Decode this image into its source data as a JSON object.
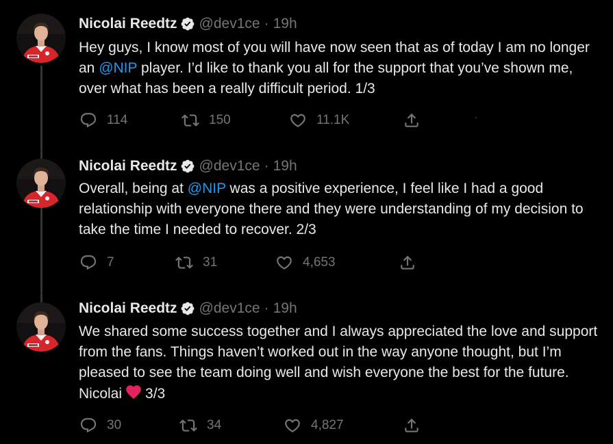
{
  "colors": {
    "background": "#000000",
    "text": "#e7e9ea",
    "muted": "#71767b",
    "link": "#1d9bf0",
    "thread_line": "#333639",
    "emoji_heart": "#e0245e"
  },
  "tweets": [
    {
      "author": {
        "name": "Nicolai Reedtz",
        "handle": "@dev1ce",
        "verified_icon": "verified-badge-icon",
        "avatar_icon": "avatar-icon"
      },
      "separator": "·",
      "time": "19h",
      "text": {
        "part1": "Hey guys, I know most of you will have now seen that as of today I am no longer an ",
        "mention": "@NIP",
        "part2": " player. I’d like to thank you all for the support that you’ve shown me, over what has been a really difficult period. 1/3"
      },
      "actions": {
        "reply": {
          "icon": "reply-icon",
          "count": "114"
        },
        "retweet": {
          "icon": "retweet-icon",
          "count": "150"
        },
        "like": {
          "icon": "heart-icon",
          "count": "11.1K"
        },
        "share": {
          "icon": "share-icon"
        }
      }
    },
    {
      "author": {
        "name": "Nicolai Reedtz",
        "handle": "@dev1ce",
        "verified_icon": "verified-badge-icon",
        "avatar_icon": "avatar-icon"
      },
      "separator": "·",
      "time": "19h",
      "text": {
        "part1": "Overall, being at ",
        "mention": "@NIP",
        "part2": " was a positive experience, I feel like I had a good relationship with everyone there and they were understanding of my decision to take the time I needed to recover. 2/3"
      },
      "actions": {
        "reply": {
          "icon": "reply-icon",
          "count": "7"
        },
        "retweet": {
          "icon": "retweet-icon",
          "count": "31"
        },
        "like": {
          "icon": "heart-icon",
          "count": "4,653"
        },
        "share": {
          "icon": "share-icon"
        }
      }
    },
    {
      "author": {
        "name": "Nicolai Reedtz",
        "handle": "@dev1ce",
        "verified_icon": "verified-badge-icon",
        "avatar_icon": "avatar-icon"
      },
      "separator": "·",
      "time": "19h",
      "text": {
        "part1": "We shared some success together and I always appreciated the love and support from the fans. Things haven’t worked out in the way anyone thought, but I’m pleased to see the team doing well and wish everyone the best for the future. Nicolai",
        "emoji": "red-heart-emoji",
        "part2": "3/3"
      },
      "actions": {
        "reply": {
          "icon": "reply-icon",
          "count": "30"
        },
        "retweet": {
          "icon": "retweet-icon",
          "count": "34"
        },
        "like": {
          "icon": "heart-icon",
          "count": "4,827"
        },
        "share": {
          "icon": "share-icon"
        }
      }
    }
  ]
}
